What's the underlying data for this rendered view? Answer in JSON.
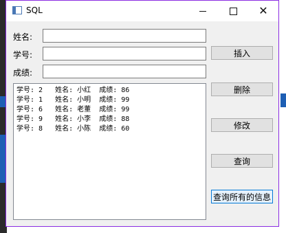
{
  "window": {
    "title": "SQL"
  },
  "form": {
    "name_label": "姓名:",
    "id_label": "学号:",
    "score_label": "成绩:",
    "name_value": "",
    "id_value": "",
    "score_value": ""
  },
  "buttons": {
    "insert": "插入",
    "delete": "删除",
    "modify": "修改",
    "query": "查询",
    "query_all": "查询所有的信息"
  },
  "results": [
    "学号: 2   姓名: 小红  成绩: 86",
    "学号: 1   姓名: 小明  成绩: 99",
    "学号: 6   姓名: 老董  成绩: 99",
    "学号: 9   姓名: 小李  成绩: 88",
    "学号: 8   姓名: 小陈  成绩: 60"
  ],
  "icons": {
    "app": "window-app-icon",
    "minimize": "minimize-icon",
    "maximize": "maximize-icon",
    "close": "close-icon"
  }
}
